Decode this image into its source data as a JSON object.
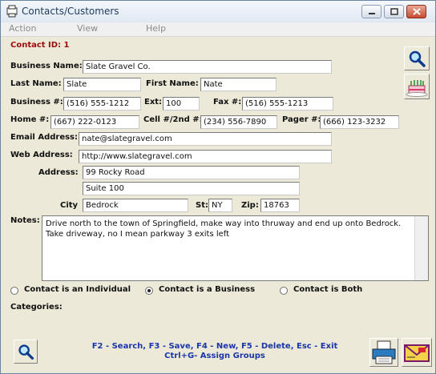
{
  "window": {
    "title": "Contacts/Customers"
  },
  "menu": {
    "items": [
      "Action",
      "View",
      "Help"
    ]
  },
  "contact": {
    "id_label": "Contact ID: 1",
    "business_name_label": "Business Name:",
    "business_name": "Slate Gravel Co.",
    "last_name_label": "Last Name:",
    "last_name": "Slate",
    "first_name_label": "First Name:",
    "first_name": "Nate",
    "business_phone_label": "Business #:",
    "business_phone": "(516) 555-1212",
    "ext_label": "Ext:",
    "ext": "100",
    "fax_label": "Fax #:",
    "fax": "(516) 555-1213",
    "home_label": "Home #:",
    "home": "(667) 222-0123",
    "cell_label": "Cell #/2nd #:",
    "cell": "(234) 556-7890",
    "pager_label": "Pager #:",
    "pager": "(666) 123-3232",
    "email_label": "Email Address:",
    "email": "nate@slategravel.com",
    "web_label": "Web Address:",
    "web": "http://www.slategravel.com",
    "address_label": "Address:",
    "address1": "99 Rocky Road",
    "address2": "Suite 100",
    "city_label": "City",
    "city": "Bedrock",
    "state_label": "St:",
    "state": "NY",
    "zip_label": "Zip:",
    "zip": "18763",
    "notes_label": "Notes:",
    "notes": "Drive north to the town of Springfield, make way into thruway and end up onto Bedrock.  Take driveway, no I mean parkway 3 exits left"
  },
  "contact_type": {
    "options": [
      "Contact is an Individual",
      "Contact is a Business",
      "Contact is Both"
    ],
    "selected": "Contact is a Business"
  },
  "categories_label": "Categories:",
  "shortcuts": {
    "line1": "F2 - Search,  F3 - Save,  F4 - New,  F5 - Delete,  Esc - Exit",
    "line2": "Ctrl+G- Assign Groups"
  },
  "icons": [
    "search-icon",
    "birthday-cake-icon",
    "printer-icon",
    "envelope-icon"
  ]
}
